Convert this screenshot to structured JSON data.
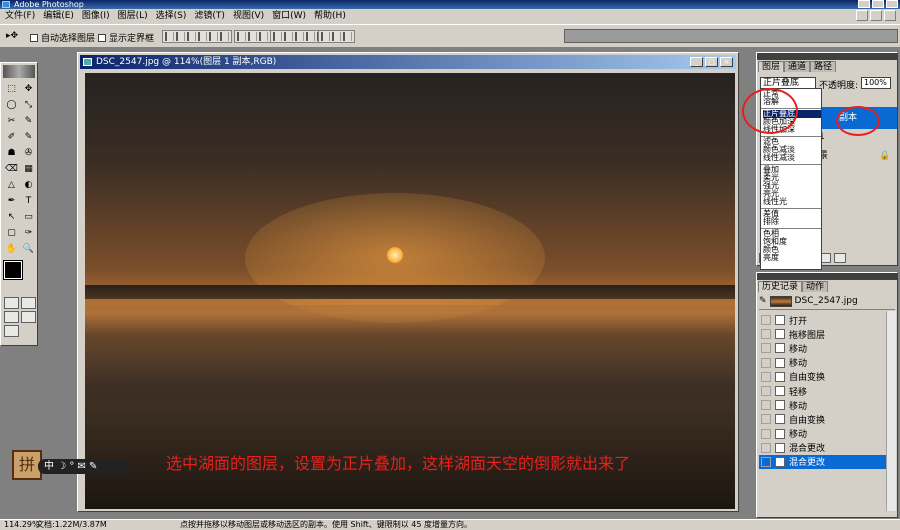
{
  "app": {
    "title": "Adobe Photoshop"
  },
  "menu": [
    "文件(F)",
    "编辑(E)",
    "图像(I)",
    "图层(L)",
    "选择(S)",
    "滤镜(T)",
    "视图(V)",
    "窗口(W)",
    "帮助(H)"
  ],
  "options": {
    "auto_select": "自动选择图层",
    "show_bounds": "显示定界框"
  },
  "toolbox": {
    "tools": [
      "⬚",
      "✥",
      "◯",
      "⤡",
      "✂",
      "✎",
      "✐",
      "✎",
      "☗",
      "✇",
      "⌫",
      "▦",
      "△",
      "◐",
      "✒",
      "T",
      "↖",
      "▭",
      "▢",
      "✑",
      "✋",
      "🔍"
    ],
    "icons": [
      "marquee-icon",
      "move-icon",
      "lasso-icon",
      "magic-wand-icon",
      "crop-icon",
      "slice-icon",
      "healing-icon",
      "brush-icon",
      "stamp-icon",
      "history-brush-icon",
      "eraser-icon",
      "gradient-icon",
      "blur-icon",
      "dodge-icon",
      "pen-icon",
      "type-icon",
      "path-select-icon",
      "shape-icon",
      "notes-icon",
      "eyedropper-icon",
      "hand-icon",
      "zoom-icon"
    ],
    "foreground_color": "#000000",
    "background_color": "#ffffff"
  },
  "document": {
    "title": "DSC_2547.jpg @ 114%(图层 1 副本,RGB)",
    "annotation": "选中湖面的图层，设置为正片叠加，这样湖面天空的倒影就出来了",
    "badge_char": "拼",
    "badge_text": "中 ☽ ° ✉ ✎"
  },
  "layers_panel": {
    "tabs": [
      "图层",
      "通道",
      "路径"
    ],
    "blend_mode": "正片叠底",
    "opacity_label": "不透明度:",
    "opacity_value": "100%",
    "rows": [
      "副本",
      "1",
      "景"
    ]
  },
  "blend_menu": {
    "groups": [
      [
        "正常",
        "溶解"
      ],
      [
        "正片叠底",
        "颜色加深",
        "线性加深"
      ],
      [
        "滤色",
        "颜色减淡",
        "线性减淡"
      ],
      [
        "叠加",
        "柔光",
        "强光",
        "亮光",
        "线性光"
      ],
      [
        "差值",
        "排除"
      ],
      [
        "色相",
        "饱和度",
        "颜色",
        "亮度"
      ]
    ],
    "selected": "正片叠底"
  },
  "history_panel": {
    "tabs": [
      "历史记录",
      "动作"
    ],
    "snapshot": "DSC_2547.jpg",
    "items": [
      "打开",
      "拖移图层",
      "移动",
      "移动",
      "自由变换",
      "轻移",
      "移动",
      "自由变换",
      "移动",
      "混合更改",
      "混合更改"
    ],
    "selected_index": 10
  },
  "status": {
    "zoom": "114.29%",
    "doc_info": "文档:1.22M/3.87M",
    "hint": "点按并拖移以移动图层或移动选区的副本。使用 Shift、键限制以 45 度增量方向。"
  }
}
